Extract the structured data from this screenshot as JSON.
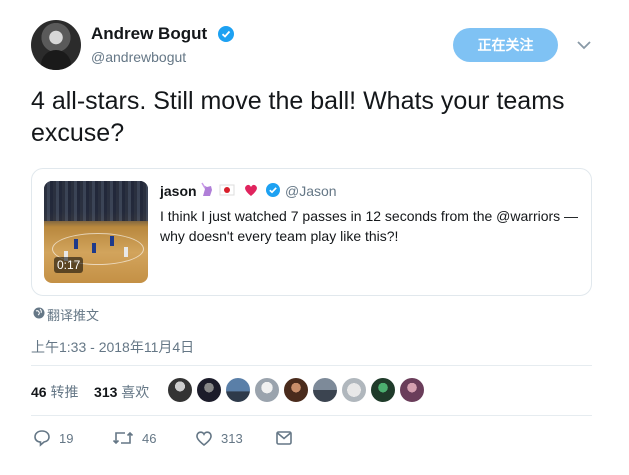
{
  "header": {
    "display_name": "Andrew Bogut",
    "handle": "@andrewbogut",
    "follow_button": "正在关注"
  },
  "tweet": {
    "text": "4 all-stars. Still move the ball! Whats your teams excuse?",
    "translate_label": "翻译推文",
    "timestamp": "上午1:33 - 2018年11月4日"
  },
  "quoted": {
    "display_name": "jason",
    "handle": "@Jason",
    "text": "I think I just watched 7 passes in 12 seconds from the @warriors — why doesn't every team play like this?!",
    "video_duration": "0:17"
  },
  "stats": {
    "retweets_count": "46",
    "retweets_label": "转推",
    "likes_count": "313",
    "likes_label": "喜欢"
  },
  "actions": {
    "reply_count": "19",
    "retweet_count": "46",
    "like_count": "313"
  },
  "colors": {
    "accent": "#1da1f2",
    "follow_button_bg": "#7fc2f4",
    "secondary_text": "#657786"
  },
  "icons": [
    "verified-icon",
    "chevron-down-icon",
    "globe-icon",
    "reply-icon",
    "retweet-icon",
    "heart-icon",
    "message-icon"
  ]
}
